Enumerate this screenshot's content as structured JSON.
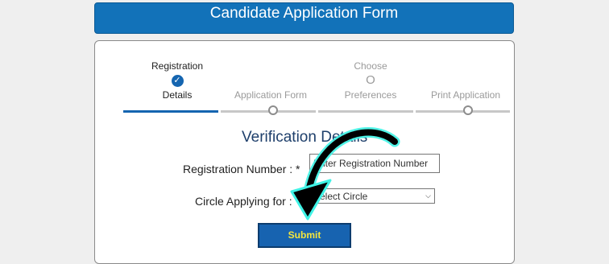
{
  "header": {
    "title": "Candidate Application Form"
  },
  "steps": [
    {
      "line1": "Registration",
      "mark": "✓",
      "line2": "Details"
    },
    {
      "line1": "",
      "mark": "",
      "line2": "Application Form"
    },
    {
      "line1": "Choose",
      "mark": "O",
      "line2": "Preferences"
    },
    {
      "line1": "",
      "mark": "",
      "line2": "Print Application"
    }
  ],
  "form": {
    "title": "Verification Details",
    "registration_label": "Registration Number : *",
    "registration_placeholder": "Enter Registration Number",
    "circle_label": "Circle Applying for : *",
    "circle_value": "Select Circle",
    "submit_label": "Submit"
  },
  "colors": {
    "primary": "#1565b0",
    "arrow_glow": "#3ff3e6",
    "submit_text": "#f5e63d"
  }
}
